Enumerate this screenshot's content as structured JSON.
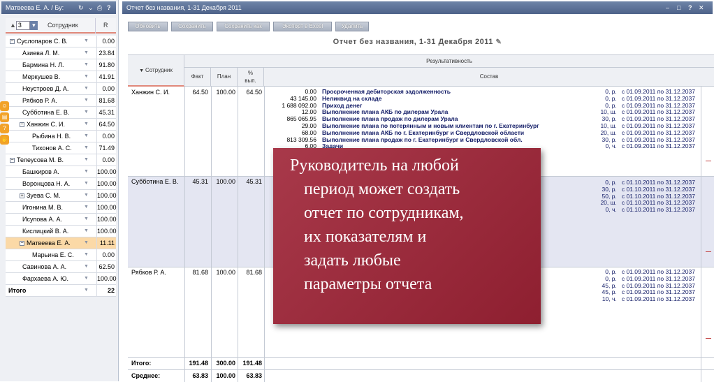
{
  "left_panel": {
    "title": "Матвеева Е. А. / Бу:",
    "title_icons": [
      "refresh-icon",
      "chevron-down-icon",
      "print-icon",
      "help-icon"
    ],
    "level_select": "3",
    "col_employee": "Сотрудник",
    "col_r": "R",
    "rows": [
      {
        "name": "Суслопаров С. В.",
        "value": "0.00",
        "box": "−"
      },
      {
        "name": "Азиева Л. М.",
        "value": "23.84",
        "box": ""
      },
      {
        "name": "Бармина Н. Л.",
        "value": "91.80",
        "box": ""
      },
      {
        "name": "Меркушев В.",
        "value": "41.91",
        "box": ""
      },
      {
        "name": "Неустроев Д. А.",
        "value": "0.00",
        "box": ""
      },
      {
        "name": "Рябков Р. А.",
        "value": "81.68",
        "box": ""
      },
      {
        "name": "Субботина Е. В.",
        "value": "45.31",
        "box": ""
      },
      {
        "name": "Ханжин С. И.",
        "value": "64.50",
        "box": "−"
      },
      {
        "name": "Рыбина Н. В.",
        "value": "0.00",
        "box": ""
      },
      {
        "name": "Тихонов А. С.",
        "value": "71.49",
        "box": ""
      },
      {
        "name": "Телеусова М. В.",
        "value": "0.00",
        "box": "−"
      },
      {
        "name": "Башкиров А.",
        "value": "100.00",
        "box": ""
      },
      {
        "name": "Воронцова Н. А.",
        "value": "100.00",
        "box": ""
      },
      {
        "name": "Зуева С. М.",
        "value": "100.00",
        "box": "+"
      },
      {
        "name": "Игонина М. В.",
        "value": "100.00",
        "box": ""
      },
      {
        "name": "Исупова А. А.",
        "value": "100.00",
        "box": ""
      },
      {
        "name": "Кислицкий В. А.",
        "value": "100.00",
        "box": ""
      },
      {
        "name": "Матвеева Е. А.",
        "value": "11.11",
        "box": "−"
      },
      {
        "name": "Марьина Е. С.",
        "value": "0.00",
        "box": ""
      },
      {
        "name": "Савинова А. А.",
        "value": "62.50",
        "box": ""
      },
      {
        "name": "Фархаева А. Ю.",
        "value": "100.00",
        "box": ""
      }
    ],
    "total_label": "Итого",
    "total_value": "22"
  },
  "main": {
    "title": "Отчет без названия, 1-31 Декабря 2011",
    "title_icons": [
      "minimize-icon",
      "maximize-icon",
      "help-icon",
      "close-icon"
    ],
    "buttons": {
      "update": "Обновить",
      "save": "Сохранить",
      "save_as": "Сохранить как",
      "export": "Экспорт в Excel",
      "delete": "Удалить"
    },
    "report_title": "Отчет без названия, 1-31 Декабря 2011",
    "headers": {
      "employee": "Сотрудник",
      "performance": "Результативность",
      "fact": "Факт",
      "plan": "План",
      "pct": "%\nвып.",
      "composition": "Состав"
    },
    "employees": [
      {
        "name": "Ханжин С. И.",
        "fact": "64.50",
        "plan": "100.00",
        "pct": "64.50",
        "values": "0.00\n43 145.00\n1 688 092.00\n12.00\n865 065.95\n29.00\n68.00\n813 309.56\n6.00",
        "indicators": [
          "Просроченная дебиторская задолженность",
          "Неликвид на складе",
          "Приход денег",
          "Выполнение плана АКБ по дилерам Урала",
          "Выполнение плана продаж по дилерам Урала",
          "Выполнение плана по потерянным и новым клиентам по г. Екатеринбург",
          "Выполнение плана АКБ по г. Екатеринбург и Свердловской области",
          "Выполнение плана продаж по г. Екатеринбург и Свердловской обл.",
          "Задачи"
        ],
        "periods": "0, р.   с 01.09.2011 по 31.12.2037\n0, р.   с 01.09.2011 по 31.12.2037\n0, р.   с 01.09.2011 по 31.12.2037\n10, ш.   с 01.09.2011 по 31.12.2037\n30, р.   с 01.09.2011 по 31.12.2037\n10, ш.   с 01.09.2011 по 31.12.2037\n20, ш.   с 01.09.2011 по 31.12.2037\n30, р.   с 01.09.2011 по 31.12.2037\n0, ч.   с 01.09.2011 по 31.12.2037"
      },
      {
        "name": "Субботина Е. В.",
        "fact": "45.31",
        "plan": "100.00",
        "pct": "45.31",
        "periods": "0, р.   с 01.10.2011 по 31.12.2037\n30, р.   с 01.10.2011 по 31.12.2037\n50, р.   с 01.10.2011 по 31.12.2037\n20, ш.   с 01.10.2011 по 31.12.2037\n0, ч.   с 01.10.2011 по 31.12.2037"
      },
      {
        "name": "Рябков Р. А.",
        "fact": "81.68",
        "plan": "100.00",
        "pct": "81.68",
        "periods": "0, р.   с 01.09.2011 по 31.12.2037\n0, р.   с 01.09.2011 по 31.12.2037\n45, р.   с 01.09.2011 по 31.12.2037\n45, р.   с 01.09.2011 по 31.12.2037\n10, ч.   с 01.09.2011 по 31.12.2037"
      }
    ],
    "total": {
      "label": "Итого:",
      "fact": "191.48",
      "plan": "300.00",
      "pct": "191.48"
    },
    "average": {
      "label": "Среднее:",
      "fact": "63.83",
      "plan": "100.00",
      "pct": "63.83"
    }
  },
  "callout": {
    "lines": [
      "Руководитель на любой",
      "период может создать",
      "отчет по сотрудникам,",
      "их показателям  и",
      "задать любые",
      "параметры отчета"
    ]
  },
  "colors": {
    "header": "#5a6f96",
    "callout": "#9a2a3b",
    "highlight_row": "#fbd9a7",
    "selected_band": "#e4e6f2"
  }
}
